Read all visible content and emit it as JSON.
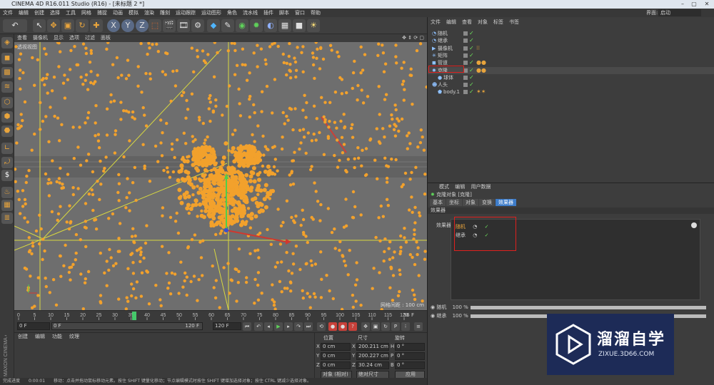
{
  "window": {
    "title": "CINEMA 4D R16.011 Studio (R16) - [未标题 2 *]",
    "layout_label": "界面:",
    "layout_value": "启动"
  },
  "menubar": [
    "文件",
    "编辑",
    "创建",
    "选择",
    "工具",
    "网格",
    "捕捉",
    "动画",
    "模拟",
    "渲染",
    "雕刻",
    "运动跟踪",
    "运动图形",
    "角色",
    "流水线",
    "插件",
    "脚本",
    "窗口",
    "帮助"
  ],
  "toolbar": {
    "icons": [
      "undo-icon",
      "pointer-icon",
      "move-icon",
      "scale-icon",
      "rotate-icon",
      "add-icon",
      "x-axis-icon",
      "y-axis-icon",
      "z-axis-icon",
      "coords-icon",
      "render-region-icon",
      "render-view-icon",
      "render-settings-icon",
      "cube-icon",
      "pen-icon",
      "subdivision-icon",
      "cloner-icon",
      "deformer-icon",
      "scene-icon",
      "camera-icon",
      "light-icon"
    ],
    "axis_labels": [
      "X",
      "Y",
      "Z"
    ]
  },
  "viewport": {
    "menu": [
      "查看",
      "摄像机",
      "显示",
      "选项",
      "过滤",
      "面板"
    ],
    "label": "透视视图",
    "scale": "网格间距 : 100 cm"
  },
  "timeline": {
    "ticks": [
      "0",
      "5",
      "10",
      "15",
      "20",
      "25",
      "30",
      "35",
      "40",
      "45",
      "50",
      "55",
      "60",
      "65",
      "70",
      "75",
      "80",
      "85",
      "90",
      "95",
      "100",
      "105",
      "110",
      "115",
      "120"
    ],
    "current_frame": "56 F",
    "current_value": 36
  },
  "playbar": {
    "start": "0 F",
    "start2": "0 F",
    "end": "120 F",
    "end2": "120 F"
  },
  "material_panel": {
    "menu": [
      "创建",
      "编辑",
      "功能",
      "纹理"
    ]
  },
  "coord_panel": {
    "headers": [
      "位置",
      "尺寸",
      "旋转"
    ],
    "rows": [
      {
        "axis": "X",
        "pos": "0 cm",
        "size_axis": "X",
        "size": "200.211 cm",
        "rot_axis": "H",
        "rot": "0 °"
      },
      {
        "axis": "Y",
        "pos": "0 cm",
        "size_axis": "Y",
        "size": "200.227 cm",
        "rot_axis": "P",
        "rot": "0 °"
      },
      {
        "axis": "Z",
        "pos": "0 cm",
        "size_axis": "Z",
        "size": "30.24 cm",
        "rot_axis": "B",
        "rot": "0 °"
      }
    ],
    "mode_left": "对象 (相对)",
    "mode_right": "绝对尺寸",
    "apply": "应用"
  },
  "status_bar": {
    "progress_label": "完成进度",
    "time": "0:00:01",
    "message": "移动：点击并拖动鼠标移动元素。按住 SHIFT 键量化移动；节点编辑模式时按住 SHIFT 键增加选择对象；按住 CTRL 键减少选择对象。"
  },
  "object_manager": {
    "menu": [
      "文件",
      "编辑",
      "查看",
      "对象",
      "标签",
      "书签"
    ],
    "objects": [
      {
        "name": "随机",
        "indent": 0,
        "tags": ""
      },
      {
        "name": "继承",
        "indent": 0,
        "tags": ""
      },
      {
        "name": "摄像机",
        "indent": 0,
        "tags": "⁝⁝"
      },
      {
        "name": "矩阵",
        "indent": 0,
        "tags": ""
      },
      {
        "name": "管道",
        "indent": 0,
        "tags": "●●"
      },
      {
        "name": "克隆",
        "indent": 0,
        "tags": "●●"
      },
      {
        "name": "球体",
        "indent": 1,
        "tags": ""
      },
      {
        "name": "人头",
        "indent": 0,
        "tags": ""
      },
      {
        "name": "body.1",
        "indent": 1,
        "tags": "✶✶"
      }
    ]
  },
  "attribute_manager": {
    "menu": [
      "模式",
      "编辑",
      "用户数据"
    ],
    "object_title": "克隆对象 [克隆]",
    "tabs": [
      "基本",
      "坐标",
      "对象",
      "变换",
      "效果器"
    ],
    "active_tab": "效果器",
    "section": "效果器",
    "field_label": "效果器",
    "effectors": [
      {
        "name": "随机"
      },
      {
        "name": "继承"
      }
    ],
    "sliders": [
      {
        "name": "随机",
        "value": "100 %",
        "fraction": 1.0
      },
      {
        "name": "继承",
        "value": "100 %",
        "fraction": 1.0
      }
    ]
  },
  "watermark": {
    "title": "溜溜自学",
    "url": "ZIXUE.3D66.COM"
  },
  "colors": {
    "accent": "#3d7cc9",
    "particle": "#f2a12c",
    "highlight_red": "#e0201e",
    "check_green": "#6de05c"
  }
}
